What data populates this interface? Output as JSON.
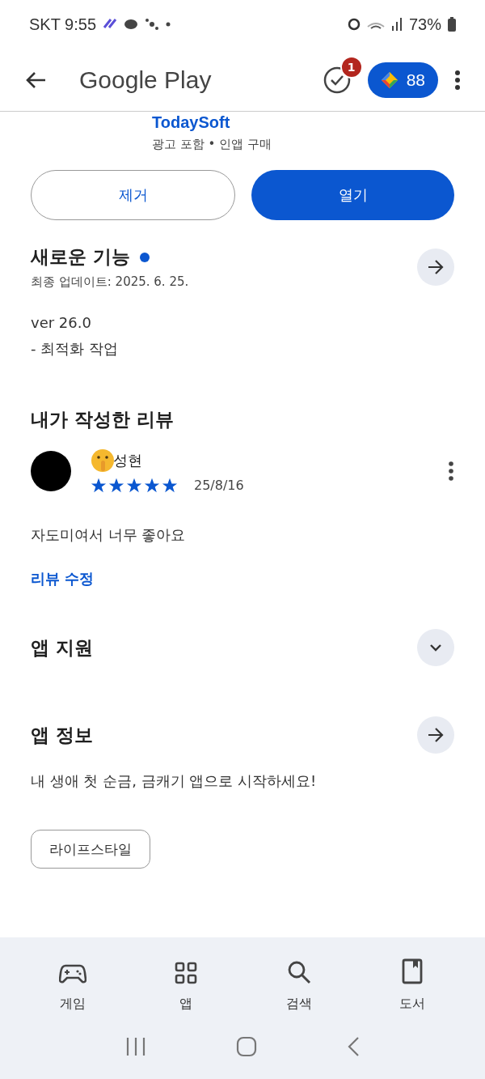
{
  "status_bar": {
    "carrier_time": "SKT 9:55",
    "battery": "73%"
  },
  "header": {
    "title": "Google Play",
    "notification_count": "1",
    "points": "88"
  },
  "app": {
    "developer": "TodaySoft",
    "tags": "광고 포함 • 인앱 구매"
  },
  "buttons": [
    {
      "label": "제거",
      "kind": "outline"
    },
    {
      "label": "열기",
      "kind": "filled"
    }
  ],
  "whats_new": {
    "title": "새로운 기능",
    "new_dot": true,
    "updated": "최종 업데이트: 2025. 6. 25.",
    "version": "ver 26.0",
    "notes": "- 최적화 작업"
  },
  "my_review": {
    "title": "내가 작성한 리뷰",
    "author": "성현",
    "stars": 5,
    "date": "25/8/16",
    "text": "자도미여서 너무 좋아요",
    "edit_link": "리뷰 수정"
  },
  "sections": [
    {
      "title": "앱 지원",
      "kind": "expand"
    },
    {
      "title": "앱 정보",
      "kind": "open"
    }
  ],
  "about": "내 생애 첫 순금, 금캐기 앱으로 시작하세요!",
  "category_chip": "라이프스타일",
  "bottom_nav": [
    {
      "label": "게임",
      "kind": "games"
    },
    {
      "label": "앱",
      "kind": "apps"
    },
    {
      "label": "검색",
      "kind": "search"
    },
    {
      "label": "도서",
      "kind": "books"
    }
  ]
}
